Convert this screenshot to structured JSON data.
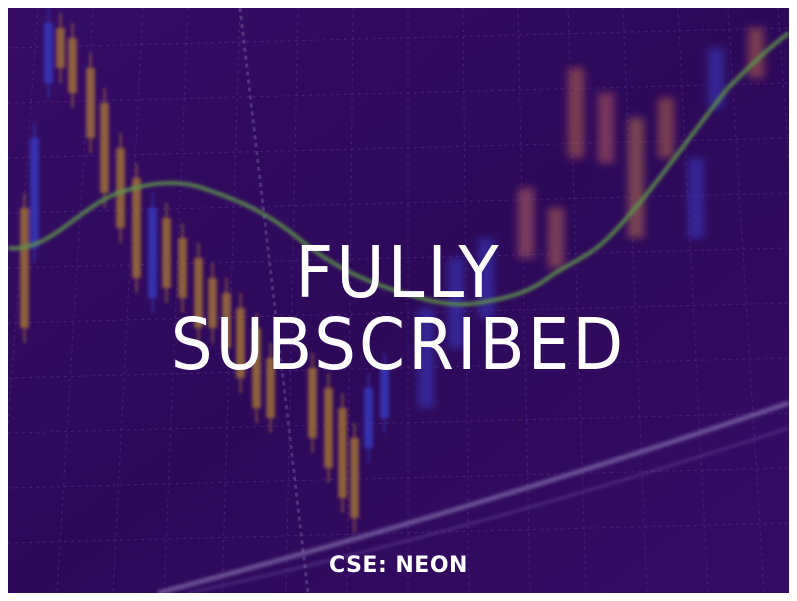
{
  "banner": {
    "headline_line1": "FULLY",
    "headline_line2": "SUBSCRIBED",
    "ticker": "CSE: NEON"
  },
  "colors": {
    "background": "#2a0a4a",
    "overlay": "#32085a",
    "candle_up": "#e8b820",
    "candle_down": "#3a5cff",
    "moving_average": "#7cff3a",
    "text": "#ffffff"
  }
}
